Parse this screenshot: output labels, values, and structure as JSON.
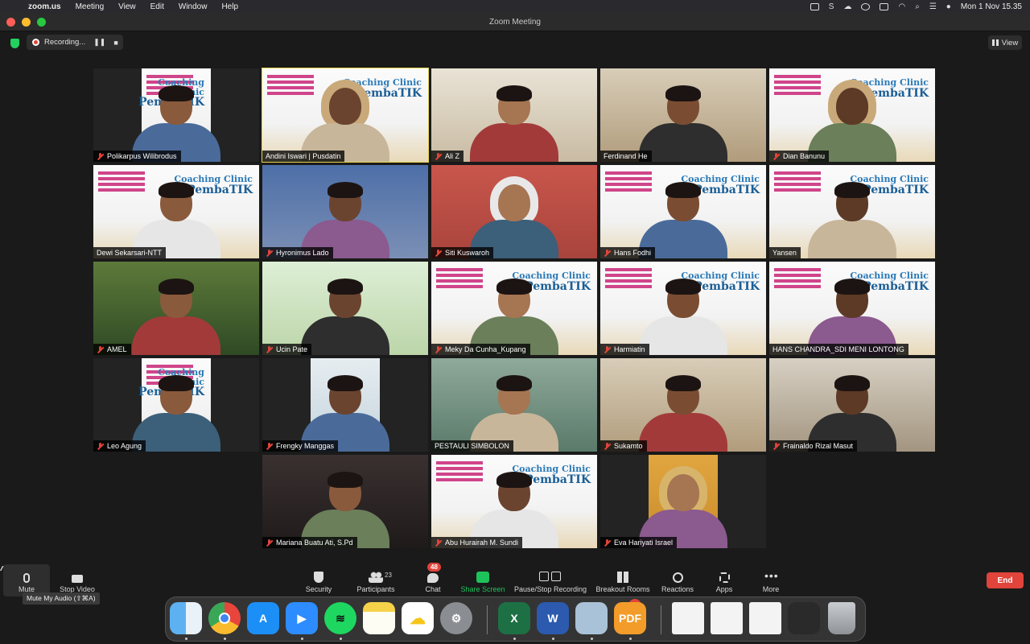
{
  "menubar": {
    "app": "zoom.us",
    "menus": [
      "Meeting",
      "View",
      "Edit",
      "Window",
      "Help"
    ],
    "clock": "Mon 1 Nov  15.35"
  },
  "window": {
    "title": "Zoom Meeting"
  },
  "recording": {
    "label": "Recording..."
  },
  "view_button": {
    "label": "View"
  },
  "participants": [
    {
      "name": "Polikarpus Wilibrodus",
      "muted": true,
      "bg": "slide"
    },
    {
      "name": "Andini Iswari | Pusdatin",
      "muted": false,
      "bg": "slide",
      "active": true
    },
    {
      "name": "Ali Z",
      "muted": true,
      "bg": "wall"
    },
    {
      "name": "Ferdinand He",
      "muted": false,
      "bg": "beige"
    },
    {
      "name": "Dian Banunu",
      "muted": true,
      "bg": "slide"
    },
    {
      "name": "Dewi Sekarsari-NTT",
      "muted": false,
      "bg": "slide"
    },
    {
      "name": "Hyronimus Lado",
      "muted": true,
      "bg": "blue"
    },
    {
      "name": "Siti Kuswaroh",
      "muted": true,
      "bg": "red"
    },
    {
      "name": "Hans Fodhi",
      "muted": true,
      "bg": "slide"
    },
    {
      "name": "Yansen",
      "muted": false,
      "bg": "slide"
    },
    {
      "name": "AMEL",
      "muted": true,
      "bg": "green"
    },
    {
      "name": "Ucin Pate",
      "muted": true,
      "bg": "lightgreen"
    },
    {
      "name": "Meky Da Cunha_Kupang",
      "muted": true,
      "bg": "slide"
    },
    {
      "name": "Harmiatin",
      "muted": true,
      "bg": "slide"
    },
    {
      "name": "HANS CHANDRA_SDI MENI LONTONG",
      "muted": false,
      "bg": "slide"
    },
    {
      "name": "Leo Agung",
      "muted": true,
      "bg": "slide"
    },
    {
      "name": "Frengky Manggas",
      "muted": true,
      "bg": "sky"
    },
    {
      "name": "PESTAULI SIMBOLON",
      "muted": false,
      "bg": "teal"
    },
    {
      "name": "Sukamto",
      "muted": true,
      "bg": "beige"
    },
    {
      "name": "Frainaldo Rizal Masut",
      "muted": true,
      "bg": "shelf"
    },
    {
      "name": "Mariana Buatu Ati, S.Pd",
      "muted": true,
      "bg": "dark"
    },
    {
      "name": "Abu Hurairah M. Sundi",
      "muted": true,
      "bg": "slide"
    },
    {
      "name": "Eva Hariyati Israel",
      "muted": true,
      "bg": "orange"
    }
  ],
  "slide": {
    "title_line1": "Coaching Clinic",
    "title_line2": "PembaTIK"
  },
  "toolbar": {
    "mute": "Mute",
    "stop_video": "Stop Video",
    "security": "Security",
    "participants": "Participants",
    "participants_count": "23",
    "chat": "Chat",
    "chat_badge": "48",
    "share_screen": "Share Screen",
    "pause_recording": "Pause/Stop Recording",
    "breakout": "Breakout Rooms",
    "reactions": "Reactions",
    "apps": "Apps",
    "more": "More",
    "end": "End"
  },
  "tooltip": "Mute My Audio (⇧⌘A)",
  "dock": {
    "apps": [
      "Finder",
      "Chrome",
      "App Store",
      "Zoom",
      "Spotify",
      "Notes",
      "Cloud",
      "System Preferences",
      "Excel",
      "Word",
      "Preview",
      "PDF Expert"
    ],
    "system_prefs_badge": "1"
  },
  "colors": {
    "accent_green": "#1ec25b",
    "end_red": "#e0443a",
    "active_speaker": "#e5d54e"
  }
}
